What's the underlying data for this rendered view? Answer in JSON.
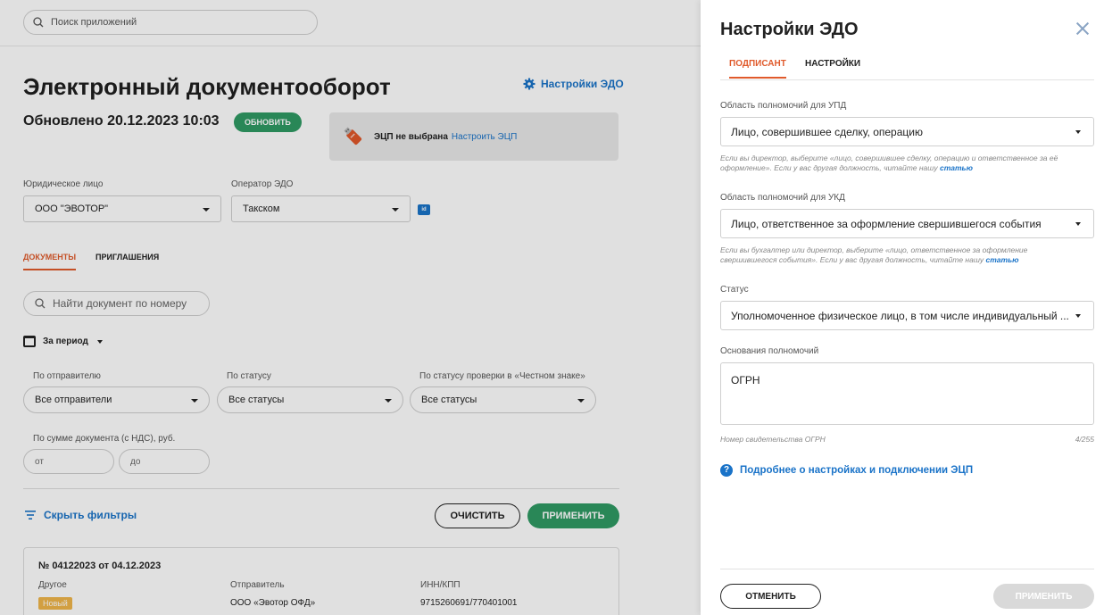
{
  "app_search": {
    "placeholder": "Поиск приложений"
  },
  "page": {
    "title": "Электронный документооборот",
    "settings_link": "Настройки ЭДО",
    "updated": "Обновлено 20.12.2023 10:03",
    "refresh_label": "ОБНОВИТЬ"
  },
  "ecp": {
    "status": "ЭЦП не выбрана",
    "configure_link": "Настроить ЭЦП"
  },
  "filters_top": {
    "legal_entity_label": "Юридическое лицо",
    "legal_entity_value": "ООО \"ЭВОТОР\"",
    "operator_label": "Оператор ЭДО",
    "operator_value": "Такском",
    "id_badge": "id"
  },
  "tabs": [
    {
      "label": "ДОКУМЕНТЫ"
    },
    {
      "label": "ПРИГЛАШЕНИЯ"
    }
  ],
  "doc_search": {
    "placeholder": "Найти документ по номеру"
  },
  "period": {
    "label": "За период"
  },
  "filters": {
    "sender_label": "По отправителю",
    "sender_value": "Все отправители",
    "status_label": "По статусу",
    "status_value": "Все статусы",
    "honest_label": "По статусу проверки в «Честном знаке»",
    "honest_value": "Все статусы",
    "sum_label": "По сумме документа (с НДС), руб.",
    "sum_from": "от",
    "sum_to": "до"
  },
  "actions": {
    "hide_filters": "Скрыть фильтры",
    "clear": "ОЧИСТИТЬ",
    "apply": "ПРИМЕНИТЬ"
  },
  "document": {
    "number": "№ 04122023 от 04.12.2023",
    "type": "Другое",
    "badge": "Новый",
    "sender_label": "Отправитель",
    "sender_value": "ООО «Эвотор ОФД»",
    "inn_label": "ИНН/КПП",
    "inn_value": "9715260691/770401001"
  },
  "drawer": {
    "title": "Настройки ЭДО",
    "tabs": [
      {
        "label": "ПОДПИСАНТ"
      },
      {
        "label": "НАСТРОЙКИ"
      }
    ],
    "upd_label": "Область полномочий для УПД",
    "upd_value": "Лицо, совершившее сделку, операцию",
    "upd_hint": "Если вы директор, выберите «лицо, совершившее сделку, операцию и ответственное за её оформление». Если у вас другая должность, читайте нашу",
    "upd_hint_link": "статью",
    "ukd_label": "Область полномочий для УКД",
    "ukd_value": "Лицо, ответственное за оформление свершившегося события",
    "ukd_hint": "Если вы бухгалтер или директор, выберите «лицо, ответственное за оформление свершившегося события». Если у вас другая должность, читайте нашу",
    "ukd_hint_link": "статью",
    "status_label": "Статус",
    "status_value": "Уполномоченное физическое лицо, в том числе индивидуальный ...",
    "basis_label": "Основания полномочий",
    "basis_value": "ОГРН",
    "basis_hint": "Номер свидетельства ОГРН",
    "basis_counter": "4/255",
    "help_link": "Подробнее о настройках и подключении ЭЦП",
    "cancel": "ОТМЕНИТЬ",
    "apply": "ПРИМЕНИТЬ"
  },
  "colors": {
    "accent_orange": "#e05a2b",
    "green": "#2f9a63",
    "link_blue": "#1a73c8",
    "disabled_gray": "#d9d9d9"
  }
}
